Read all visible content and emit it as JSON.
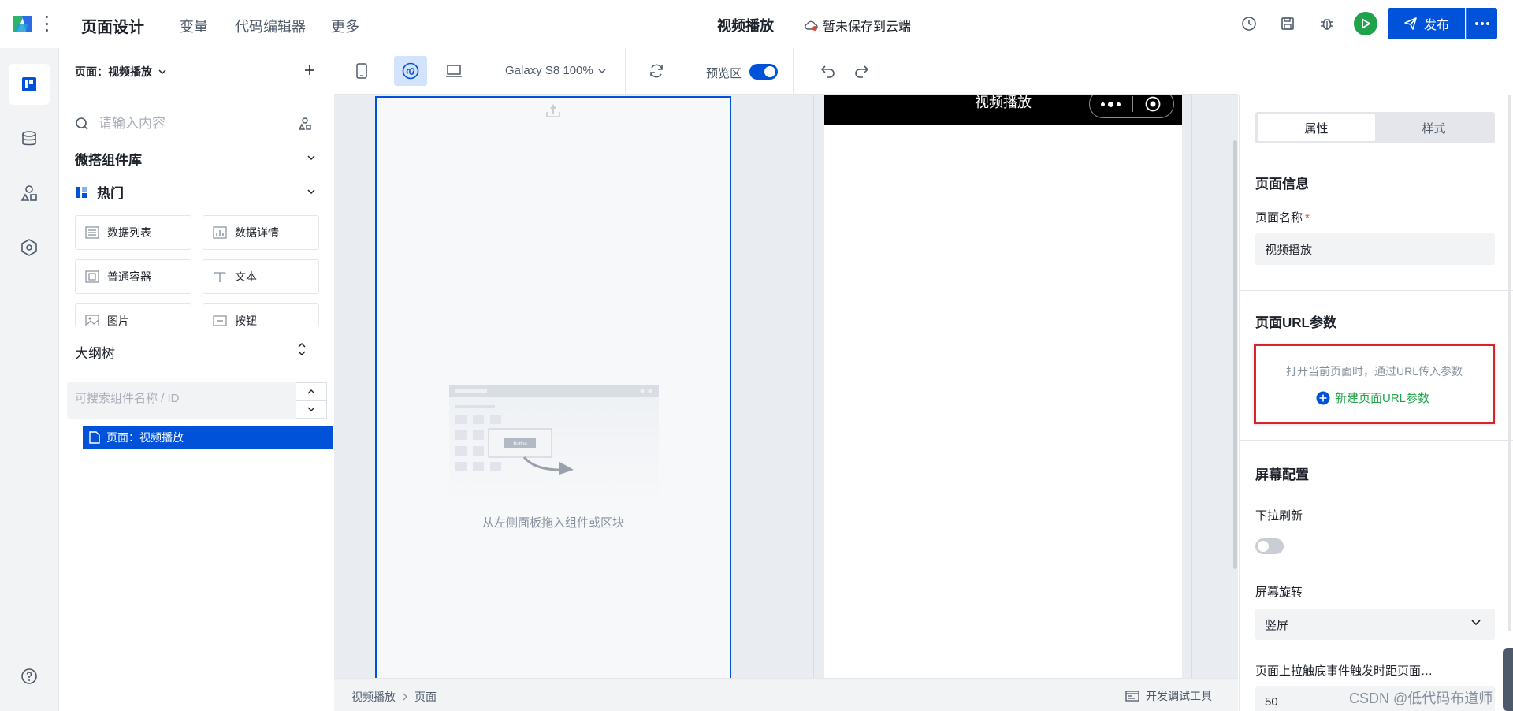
{
  "header": {
    "title": "页面设计",
    "menu": [
      "变量",
      "代码编辑器",
      "更多"
    ],
    "current_page": "视频播放",
    "save_status": "暂未保存到云端",
    "publish_label": "发布"
  },
  "left_panel": {
    "page_selector": "页面：视频播放",
    "search_placeholder": "请输入内容",
    "library_title": "微搭组件库",
    "hot_title": "热门",
    "components": [
      {
        "label": "数据列表",
        "icon": "list-icon"
      },
      {
        "label": "数据详情",
        "icon": "chart-icon"
      },
      {
        "label": "普通容器",
        "icon": "container-icon"
      },
      {
        "label": "文本",
        "icon": "text-icon"
      },
      {
        "label": "图片",
        "icon": "image-icon"
      },
      {
        "label": "按钮",
        "icon": "button-icon"
      }
    ],
    "outline_title": "大纲树",
    "outline_search_placeholder": "可搜索组件名称 / ID",
    "tree_node": "页面：视频播放"
  },
  "toolbar": {
    "device": "Galaxy S8 100%",
    "preview_label": "预览区",
    "preview_enabled": true
  },
  "canvas": {
    "empty_text": "从左侧面板拖入组件或区块",
    "illustration_button": "Button",
    "preview_title": "视频播放"
  },
  "statusbar": {
    "breadcrumb": [
      "视频播放",
      "页面"
    ],
    "devtools_label": "开发调试工具"
  },
  "right_panel": {
    "tabs": [
      "属性",
      "样式"
    ],
    "active_tab": "属性",
    "page_info_title": "页面信息",
    "page_name_label": "页面名称",
    "required_mark": "*",
    "page_name_value": "视频播放",
    "url_params_title": "页面URL参数",
    "url_params_hint": "打开当前页面时，通过URL传入参数",
    "url_params_add": "新建页面URL参数",
    "screen_config_title": "屏幕配置",
    "pull_refresh_label": "下拉刷新",
    "pull_refresh_enabled": false,
    "rotation_label": "屏幕旋转",
    "rotation_value": "竖屏",
    "reach_bottom_label": "页面上拉触底事件触发时距页面…",
    "reach_bottom_value": "50"
  },
  "watermark": "CSDN @低代码布道师",
  "colors": {
    "primary": "#0052d9",
    "success": "#1fa34a",
    "highlight_border": "#d9222a"
  }
}
